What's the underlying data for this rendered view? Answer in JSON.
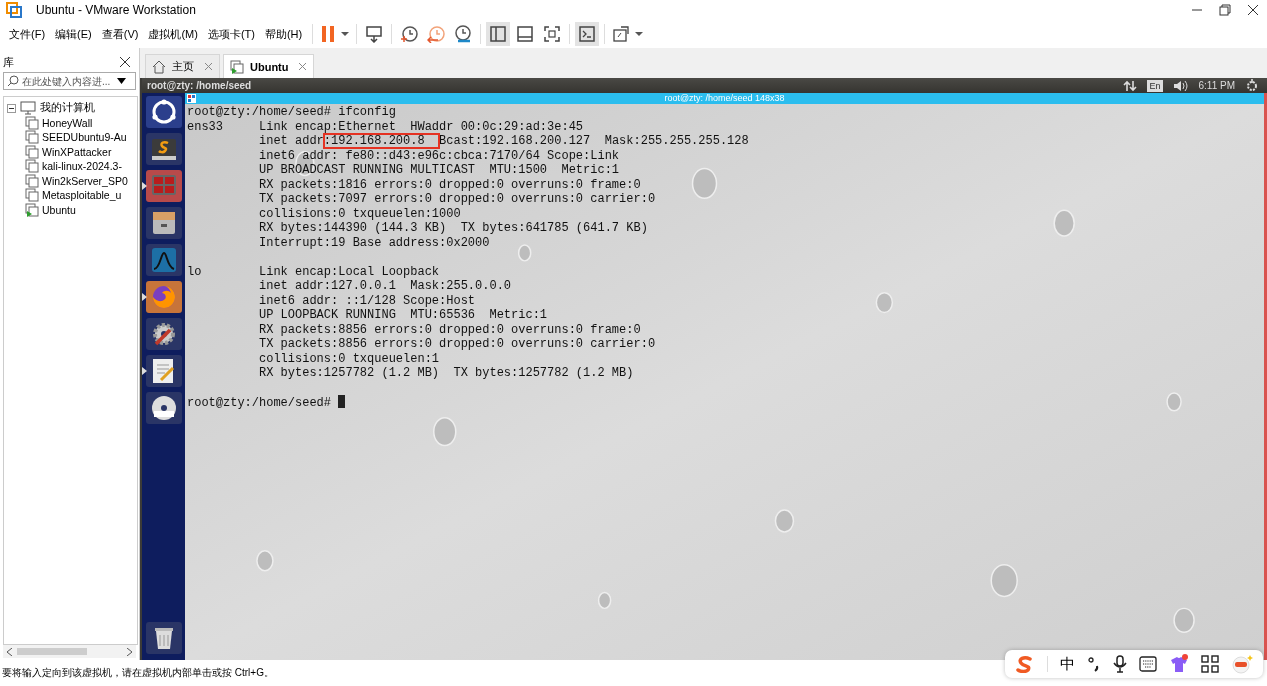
{
  "window": {
    "title": "Ubuntu - VMware Workstation"
  },
  "menu": [
    "文件(F)",
    "编辑(E)",
    "查看(V)",
    "虚拟机(M)",
    "选项卡(T)",
    "帮助(H)"
  ],
  "toolbar_groups": [
    {
      "items": [
        {
          "kind": "pause",
          "pressed": false,
          "dropdown": true
        }
      ]
    },
    {
      "items": [
        {
          "kind": "send-keys",
          "pressed": false,
          "dropdown": false
        }
      ]
    },
    {
      "items": [
        {
          "kind": "snapshot-take",
          "pressed": false,
          "dropdown": false
        },
        {
          "kind": "snapshot-revert",
          "pressed": false,
          "dropdown": false
        },
        {
          "kind": "snapshot-manager",
          "pressed": false,
          "dropdown": false
        }
      ]
    },
    {
      "items": [
        {
          "kind": "library-view",
          "pressed": true,
          "dropdown": false
        },
        {
          "kind": "thumbnail-view",
          "pressed": false,
          "dropdown": false
        },
        {
          "kind": "fullscreen",
          "pressed": false,
          "dropdown": false
        }
      ]
    },
    {
      "items": [
        {
          "kind": "console",
          "pressed": true,
          "dropdown": false
        }
      ]
    },
    {
      "items": [
        {
          "kind": "stretch",
          "pressed": false,
          "dropdown": true
        }
      ]
    }
  ],
  "library": {
    "title": "库",
    "search": {
      "placeholder": "在此处键入内容进..."
    },
    "tree": [
      {
        "label": "我的计算机",
        "expanded": true,
        "children": [
          {
            "label": "HoneyWall",
            "running": false
          },
          {
            "label": "SEEDUbuntu9-Au",
            "running": false
          },
          {
            "label": "WinXPattacker",
            "running": false
          },
          {
            "label": "kali-linux-2024.3-",
            "running": false
          },
          {
            "label": "Win2kServer_SP0",
            "running": false
          },
          {
            "label": "Metasploitable_u",
            "running": false
          },
          {
            "label": "Ubuntu",
            "running": true
          }
        ]
      }
    ]
  },
  "tabs": [
    {
      "label": "主页",
      "kind": "home",
      "selected": false
    },
    {
      "label": "Ubuntu",
      "kind": "vm",
      "selected": true
    }
  ],
  "guest": {
    "panel_title": "root@zty: /home/seed",
    "keyboard_layout": "En",
    "clock": "6:11 PM",
    "launcher": [
      {
        "kind": "dash",
        "running": false
      },
      {
        "kind": "editor",
        "running": false
      },
      {
        "kind": "workspaces",
        "running": true
      },
      {
        "kind": "files",
        "running": false
      },
      {
        "kind": "wave",
        "running": false
      },
      {
        "kind": "browser",
        "running": true
      },
      {
        "kind": "settings",
        "running": false
      },
      {
        "kind": "text-editor",
        "running": true
      },
      {
        "kind": "dvd",
        "running": false
      },
      {
        "kind": "trash",
        "running": false
      }
    ],
    "terminal": {
      "title": "root@zty: /home/seed 148x38",
      "lines": [
        {
          "kind": "text",
          "text": "root@zty:/home/seed# ifconfig"
        },
        {
          "kind": "text",
          "text": "ens33     Link encap:Ethernet  HWaddr 00:0c:29:ad:3e:45"
        },
        {
          "kind": "marked",
          "parts": [
            "          inet addr",
            ":192.168.200.8  ",
            "Bcast:192.168.200.127  Mask:255.255.255.128"
          ]
        },
        {
          "kind": "text",
          "text": "          inet6 addr: fe80::d43:e96c:cbca:7170/64 Scope:Link"
        },
        {
          "kind": "text",
          "text": "          UP BROADCAST RUNNING MULTICAST  MTU:1500  Metric:1"
        },
        {
          "kind": "text",
          "text": "          RX packets:1816 errors:0 dropped:0 overruns:0 frame:0"
        },
        {
          "kind": "text",
          "text": "          TX packets:7097 errors:0 dropped:0 overruns:0 carrier:0"
        },
        {
          "kind": "text",
          "text": "          collisions:0 txqueuelen:1000"
        },
        {
          "kind": "text",
          "text": "          RX bytes:144390 (144.3 KB)  TX bytes:641785 (641.7 KB)"
        },
        {
          "kind": "text",
          "text": "          Interrupt:19 Base address:0x2000"
        },
        {
          "kind": "blank"
        },
        {
          "kind": "text",
          "text": "lo        Link encap:Local Loopback"
        },
        {
          "kind": "text",
          "text": "          inet addr:127.0.0.1  Mask:255.0.0.0"
        },
        {
          "kind": "text",
          "text": "          inet6 addr: ::1/128 Scope:Host"
        },
        {
          "kind": "text",
          "text": "          UP LOOPBACK RUNNING  MTU:65536  Metric:1"
        },
        {
          "kind": "text",
          "text": "          RX packets:8856 errors:0 dropped:0 overruns:0 frame:0"
        },
        {
          "kind": "text",
          "text": "          TX packets:8856 errors:0 dropped:0 overruns:0 carrier:0"
        },
        {
          "kind": "text",
          "text": "          collisions:0 txqueuelen:1"
        },
        {
          "kind": "text",
          "text": "          RX bytes:1257782 (1.2 MB)  TX bytes:1257782 (1.2 MB)"
        },
        {
          "kind": "blank"
        },
        {
          "kind": "prompt",
          "text": "root@zty:/home/seed# "
        }
      ]
    }
  },
  "status_bar": {
    "text": "要将输入定向到该虚拟机，请在虚拟机内部单击或按 Ctrl+G。"
  },
  "ime_bar": {
    "mode": "中"
  }
}
